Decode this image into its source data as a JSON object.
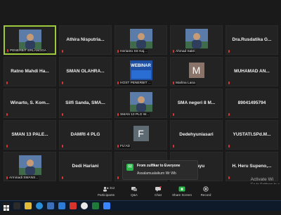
{
  "tiles": [
    {
      "name": "",
      "label": "PENERBIT ERLANGGA",
      "media": "photo",
      "active": true
    },
    {
      "name": "Athira Nisputria...",
      "label": "",
      "media": "none"
    },
    {
      "name": "",
      "label": "Herianto SS Kaj...",
      "media": "photo"
    },
    {
      "name": "",
      "label": "Ahmad Sakri",
      "media": "photo"
    },
    {
      "name": "Dra.Rusdatika G...",
      "label": "",
      "media": "none"
    },
    {
      "name": "Ratno Mahdi Ha...",
      "label": "",
      "media": "none"
    },
    {
      "name": "SMAN OLAHRA...",
      "label": "",
      "media": "none"
    },
    {
      "name": "",
      "label": "HOST PENERBIT ...",
      "media": "webinar",
      "webinar_text": "WEBINAR"
    },
    {
      "name": "",
      "label": "Marlina Lana",
      "media": "letter",
      "letter": "M",
      "letter_color": "#8a7469"
    },
    {
      "name": "MUHAMAD AN...",
      "label": "",
      "media": "none"
    },
    {
      "name": "Winarto, S. Kom...",
      "label": "",
      "media": "none"
    },
    {
      "name": "Silfi Sanda, SMA...",
      "label": "",
      "media": "none"
    },
    {
      "name": "",
      "label": "SMAN 10 PLG W...",
      "media": "photo"
    },
    {
      "name": "SMA negeri 8 M...",
      "label": "",
      "media": "none"
    },
    {
      "name": "89041495794",
      "label": "",
      "media": "none"
    },
    {
      "name": "SMAN 13 PALE...",
      "label": "",
      "media": "none"
    },
    {
      "name": "DAMRI 4 PLG",
      "label": "",
      "media": "none"
    },
    {
      "name": "",
      "label": "FU'AD",
      "media": "letter",
      "letter": "F",
      "letter_color": "#5f6b73"
    },
    {
      "name": "Dedehyuniasari",
      "label": "",
      "media": "none"
    },
    {
      "name": "YUSTATI.SPd.M...",
      "label": "",
      "media": "none"
    },
    {
      "name": "",
      "label": "Arminadi SMANS...",
      "media": "photo"
    },
    {
      "name": "Dedi Hariani",
      "label": "",
      "media": "none"
    },
    {
      "name": "",
      "label": "",
      "media": "none"
    },
    {
      "name": "Rahayu",
      "label": "",
      "media": "none"
    },
    {
      "name": "H. Heru Supeno,...",
      "label": "",
      "media": "none"
    }
  ],
  "chat_popup": {
    "from": "From zulfikar to Everyone",
    "message": "Assalamualaikum Wr Wb"
  },
  "toolbar": {
    "participants_count": "312",
    "participants": "Participants",
    "qa": "Q&A",
    "chat": "Chat",
    "share_screen": "Share Screen",
    "record": "Record"
  },
  "activate_windows": {
    "title": "Activate Wi",
    "sub": "Go to Settings to a"
  },
  "colors": {
    "active_border": "#9ec93d",
    "share_green": "#2db84a",
    "mute_red": "#dd3333"
  }
}
